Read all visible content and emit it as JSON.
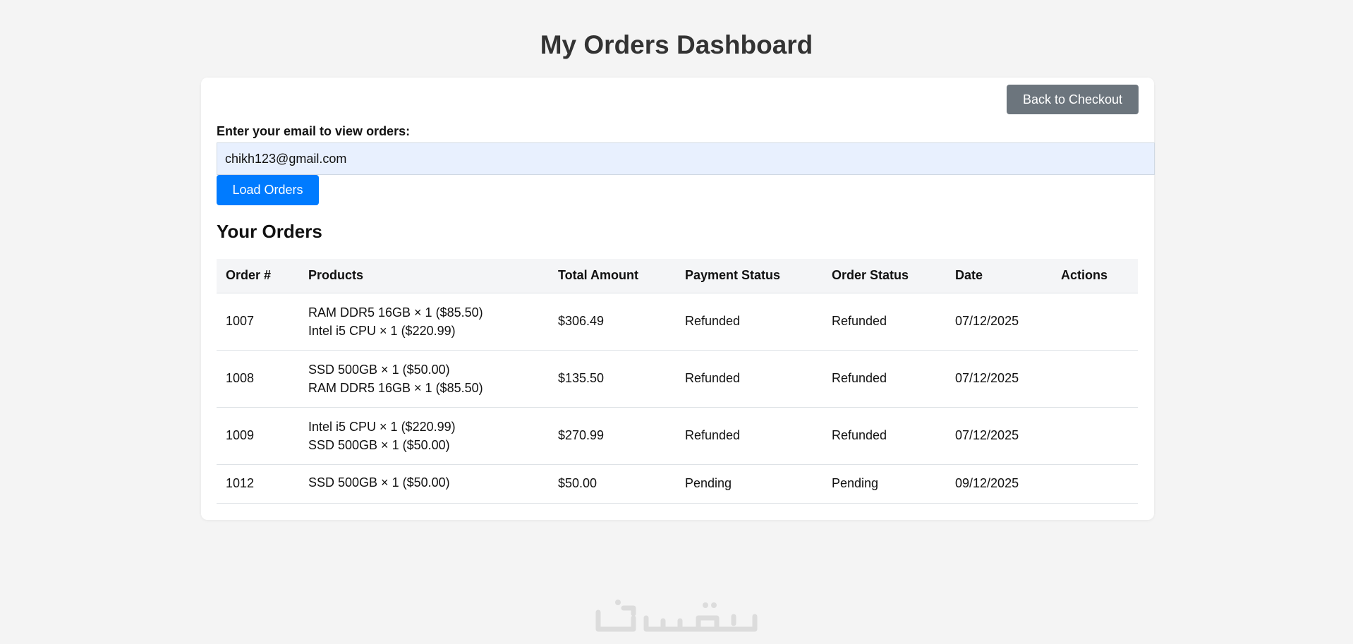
{
  "page": {
    "title": "My Orders Dashboard"
  },
  "toolbar": {
    "back_label": "Back to Checkout"
  },
  "email_form": {
    "label": "Enter your email to view orders:",
    "value": "chikh123@gmail.com",
    "submit_label": "Load Orders"
  },
  "orders": {
    "title": "Your Orders",
    "columns": [
      "Order #",
      "Products",
      "Total Amount",
      "Payment Status",
      "Order Status",
      "Date",
      "Actions"
    ],
    "rows": [
      {
        "order_no": "1007",
        "products": [
          "RAM DDR5 16GB × 1 ($85.50)",
          "Intel i5 CPU × 1 ($220.99)"
        ],
        "total": "$306.49",
        "payment_status": "Refunded",
        "order_status": "Refunded",
        "date": "07/12/2025",
        "actions": ""
      },
      {
        "order_no": "1008",
        "products": [
          "SSD 500GB × 1 ($50.00)",
          "RAM DDR5 16GB × 1 ($85.50)"
        ],
        "total": "$135.50",
        "payment_status": "Refunded",
        "order_status": "Refunded",
        "date": "07/12/2025",
        "actions": ""
      },
      {
        "order_no": "1009",
        "products": [
          "Intel i5 CPU × 1 ($220.99)",
          "SSD 500GB × 1 ($50.00)"
        ],
        "total": "$270.99",
        "payment_status": "Refunded",
        "order_status": "Refunded",
        "date": "07/12/2025",
        "actions": ""
      },
      {
        "order_no": "1012",
        "products": [
          "SSD 500GB × 1 ($50.00)"
        ],
        "total": "$50.00",
        "payment_status": "Pending",
        "order_status": "Pending",
        "date": "09/12/2025",
        "actions": ""
      }
    ]
  },
  "watermark": {
    "text": "خمسات"
  },
  "colors": {
    "accent": "#007bff",
    "secondary": "#6c757d",
    "refunded": "#6c757d",
    "pending": "#ffc107",
    "background": "#f4f4f4"
  }
}
